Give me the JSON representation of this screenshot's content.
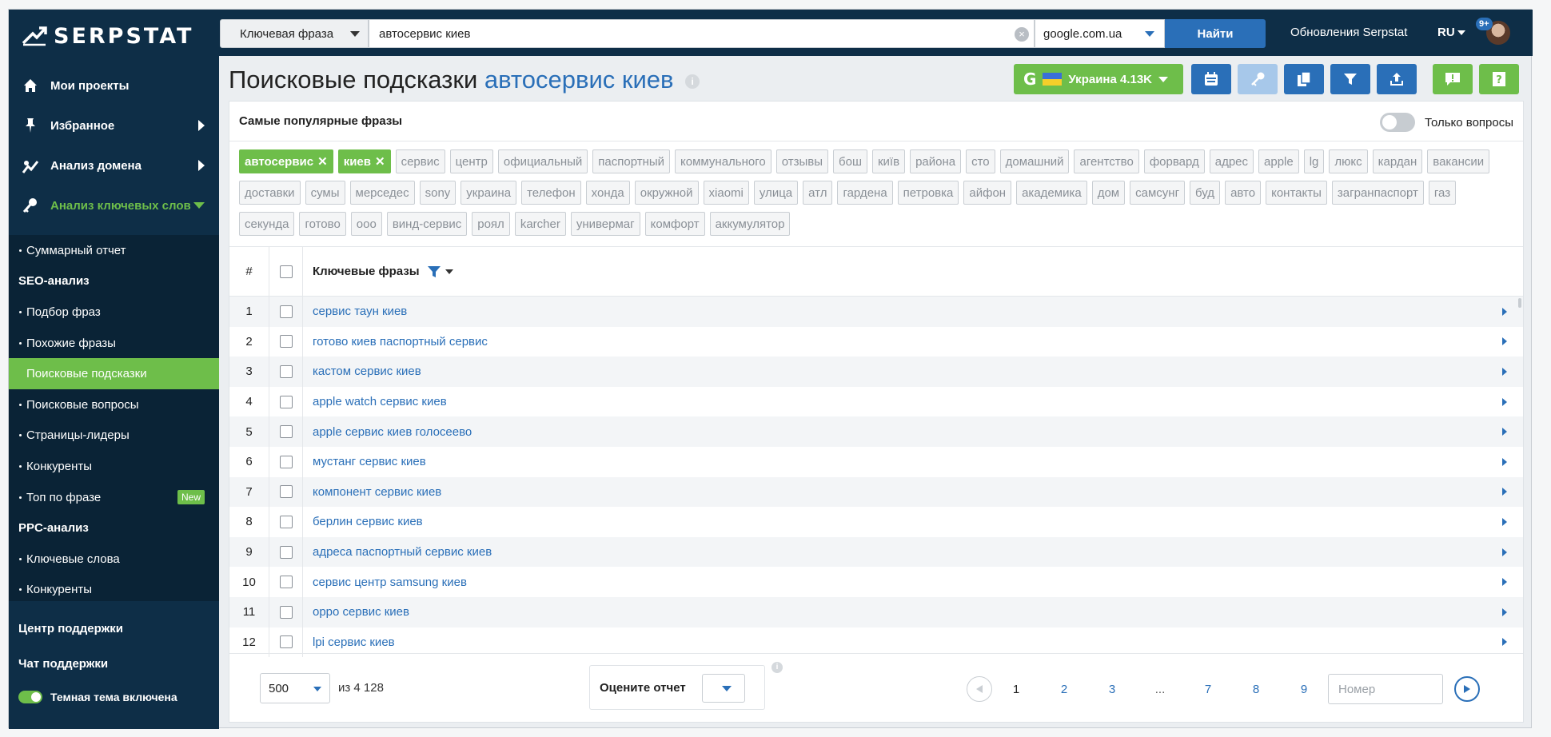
{
  "logo": {
    "text": "SERPSTAT"
  },
  "topbar": {
    "search_type": "Ключевая фраза",
    "query": "автосервис киев",
    "engine": "google.com.ua",
    "find_label": "Найти",
    "updates_label": "Обновления Serpstat",
    "lang": "RU",
    "notif_count": "9+"
  },
  "sidebar": {
    "main": [
      {
        "label": "Мои проекты",
        "icon": "home-icon"
      },
      {
        "label": "Избранное",
        "icon": "pin-icon"
      },
      {
        "label": "Анализ домена",
        "icon": "chart-icon"
      },
      {
        "label": "Анализ ключевых слов",
        "icon": "key-icon"
      }
    ],
    "sub": [
      {
        "label": "Суммарный отчет"
      },
      {
        "label": "SEO-анализ"
      },
      {
        "label": "Подбор фраз"
      },
      {
        "label": "Похожие фразы"
      },
      {
        "label": "Поисковые подсказки"
      },
      {
        "label": "Поисковые вопросы"
      },
      {
        "label": "Страницы-лидеры"
      },
      {
        "label": "Конкуренты"
      },
      {
        "label": "Топ по фразе",
        "badge": "New"
      },
      {
        "label": "PPC-анализ"
      },
      {
        "label": "Ключевые слова"
      },
      {
        "label": "Конкуренты"
      }
    ],
    "bottom": {
      "support_center": "Центр поддержки",
      "support_chat": "Чат поддержки",
      "dark_theme": "Темная тема включена"
    }
  },
  "page": {
    "title_prefix": "Поисковые подсказки",
    "title_keyword": "автосервис киев",
    "region_label": "Украина 4.13K",
    "g_letter": "G"
  },
  "popular": {
    "heading": "Самые популярные фразы",
    "only_questions": "Только вопросы",
    "active_tags": [
      "автосервис",
      "киев"
    ],
    "tags": [
      "сервис",
      "центр",
      "официальный",
      "паспортный",
      "коммунального",
      "отзывы",
      "бош",
      "київ",
      "района",
      "сто",
      "домашний",
      "агентство",
      "форвард",
      "адрес",
      "apple",
      "lg",
      "люкс",
      "кардан",
      "вакансии",
      "доставки",
      "сумы",
      "мерседес",
      "sony",
      "украина",
      "телефон",
      "хонда",
      "окружной",
      "xiaomi",
      "улица",
      "атл",
      "гардена",
      "петровка",
      "айфон",
      "академика",
      "дом",
      "самсунг",
      "буд",
      "авто",
      "контакты",
      "загранпаспорт",
      "газ",
      "секунда",
      "готово",
      "ооо",
      "винд-сервис",
      "роял",
      "karcher",
      "универмаг",
      "комфорт",
      "аккумулятор"
    ]
  },
  "table": {
    "col_num": "#",
    "col_keyword": "Ключевые фразы",
    "rows": [
      {
        "n": "1",
        "kw": "сервис таун киев"
      },
      {
        "n": "2",
        "kw": "готово киев паспортный сервис"
      },
      {
        "n": "3",
        "kw": "кастом сервис киев"
      },
      {
        "n": "4",
        "kw": "apple watch сервис киев"
      },
      {
        "n": "5",
        "kw": "apple сервис киев голосеево"
      },
      {
        "n": "6",
        "kw": "мустанг сервис киев"
      },
      {
        "n": "7",
        "kw": "компонент сервис киев"
      },
      {
        "n": "8",
        "kw": "берлин сервис киев"
      },
      {
        "n": "9",
        "kw": "адреса паспортный сервис киев"
      },
      {
        "n": "10",
        "kw": "сервис центр samsung киев"
      },
      {
        "n": "11",
        "kw": "oppo сервис киев"
      },
      {
        "n": "12",
        "kw": "lpi сервис киев"
      }
    ]
  },
  "footer": {
    "per_page": "500",
    "total": "из 4 128",
    "rate_label": "Оцените отчет",
    "pages": [
      "1",
      "2",
      "3",
      "...",
      "7",
      "8",
      "9"
    ],
    "page_placeholder": "Номер"
  }
}
